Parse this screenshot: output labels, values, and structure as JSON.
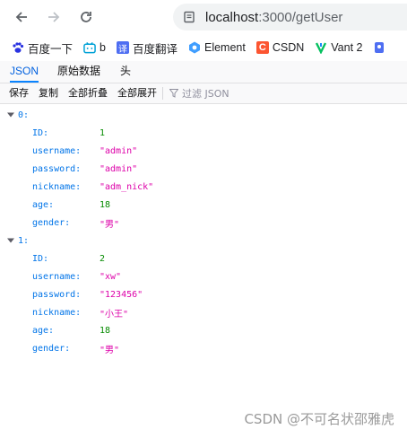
{
  "browser": {
    "url_host": "localhost",
    "url_rest": ":3000/getUser"
  },
  "bookmarks": [
    {
      "label": "百度一下",
      "icon": "paw-icon"
    },
    {
      "label": "b",
      "icon": "bilibili-icon"
    },
    {
      "label": "百度翻译",
      "icon": "translate-icon"
    },
    {
      "label": "Element",
      "icon": "element-icon"
    },
    {
      "label": "CSDN",
      "icon": "csdn-icon"
    },
    {
      "label": "Vant 2",
      "icon": "vant-icon"
    }
  ],
  "viewer": {
    "tabs": [
      "JSON",
      "原始数据",
      "头"
    ],
    "toolbar": [
      "保存",
      "复制",
      "全部折叠",
      "全部展开"
    ],
    "filter_placeholder": "过滤 JSON"
  },
  "json": [
    {
      "index": "0:",
      "fields": [
        {
          "key": "ID:",
          "value": "1",
          "type": "num"
        },
        {
          "key": "username:",
          "value": "\"admin\"",
          "type": "str"
        },
        {
          "key": "password:",
          "value": "\"admin\"",
          "type": "str"
        },
        {
          "key": "nickname:",
          "value": "\"adm_nick\"",
          "type": "str"
        },
        {
          "key": "age:",
          "value": "18",
          "type": "num"
        },
        {
          "key": "gender:",
          "value": "\"男\"",
          "type": "str"
        }
      ]
    },
    {
      "index": "1:",
      "fields": [
        {
          "key": "ID:",
          "value": "2",
          "type": "num"
        },
        {
          "key": "username:",
          "value": "\"xw\"",
          "type": "str"
        },
        {
          "key": "password:",
          "value": "\"123456\"",
          "type": "str"
        },
        {
          "key": "nickname:",
          "value": "\"小王\"",
          "type": "str"
        },
        {
          "key": "age:",
          "value": "18",
          "type": "num"
        },
        {
          "key": "gender:",
          "value": "\"男\"",
          "type": "str"
        }
      ]
    }
  ],
  "watermark": "CSDN @不可名状邵雅虎"
}
